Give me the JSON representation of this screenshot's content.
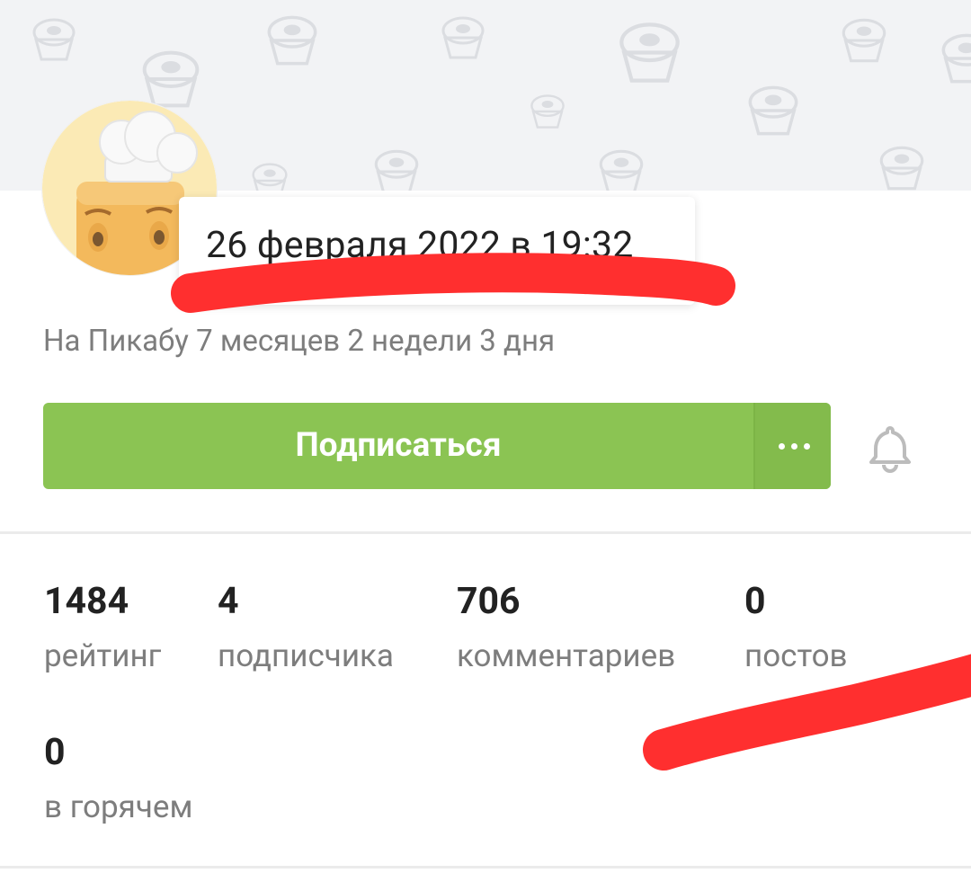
{
  "tooltip": {
    "registered": "26 февраля 2022 в 19:32"
  },
  "profile": {
    "since": "На Пикабу 7 месяцев 2 недели 3 дня"
  },
  "actions": {
    "subscribe_label": "Подписаться",
    "more_icon": "more-horizontal-icon",
    "bell_icon": "bell-icon"
  },
  "stats": [
    {
      "value": "1484",
      "label": "рейтинг"
    },
    {
      "value": "4",
      "label": "подписчика"
    },
    {
      "value": "706",
      "label": "комментариев"
    },
    {
      "value": "0",
      "label": "постов"
    },
    {
      "value": "0",
      "label": "в горячем"
    }
  ],
  "colors": {
    "subscribe_green": "#8bc453",
    "annotation_red": "#ff2f2f"
  }
}
